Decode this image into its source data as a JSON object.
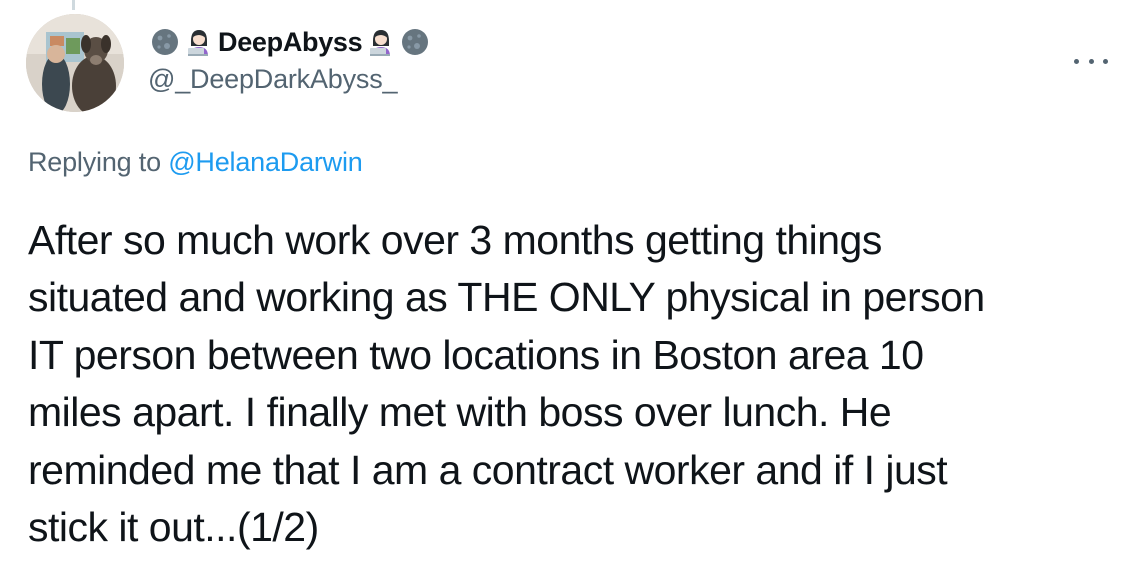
{
  "tweet": {
    "author": {
      "display_name": "DeepAbyss",
      "handle": "@_DeepDarkAbyss_",
      "avatar_icon": "avatar-dog-child-icon",
      "name_emojis": [
        "new-moon-icon",
        "woman-technologist-icon",
        "woman-technologist-icon",
        "new-moon-icon"
      ]
    },
    "reply_prefix": "Replying to",
    "reply_to": "@HelanaDarwin",
    "text": "After so much work over 3 months getting things\nsituated and working as THE ONLY physical in person\nIT person between two locations in Boston area 10\nmiles apart. I finally met with boss over lunch. He\nreminded me that I am a contract worker and if I just\nstick it out...(1/2)",
    "more_icon": "more-options-icon"
  },
  "colors": {
    "text": "#0f1419",
    "secondary": "#536471",
    "link": "#1d9bf0",
    "background": "#ffffff"
  }
}
